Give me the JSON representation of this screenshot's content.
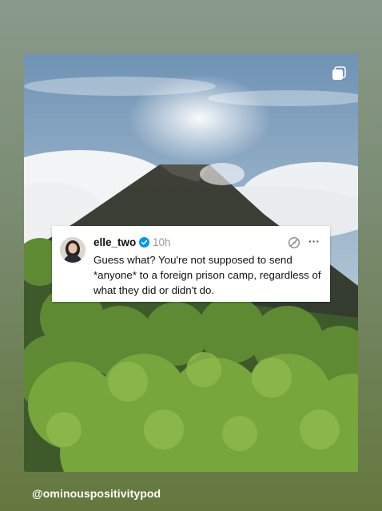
{
  "post": {
    "username": "elle_two",
    "timestamp": "10h",
    "text": "Guess what? You're not supposed to send *anyone* to a foreign prison camp, regardless of what they did or didn't do.",
    "verified": true
  },
  "story": {
    "handle": "@ominouspositivitypod"
  },
  "icons": {
    "verified": "verified-badge-icon",
    "action": "no-repost-icon",
    "more": "more-options-icon",
    "multi": "multiple-images-icon"
  },
  "colors": {
    "verified_blue": "#0095f6",
    "background_top": "#8a9a8b",
    "background_bottom": "#66783f"
  }
}
